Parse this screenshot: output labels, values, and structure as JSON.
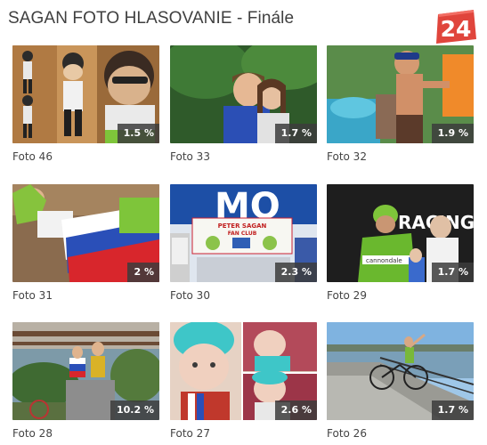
{
  "header": {
    "title": "SAGAN FOTO HLASOVANIE - Finále",
    "logo_text": "24"
  },
  "photos": [
    {
      "caption": "Foto 46",
      "percent": "1.5 %"
    },
    {
      "caption": "Foto 33",
      "percent": "1.7 %"
    },
    {
      "caption": "Foto 32",
      "percent": "1.9 %"
    },
    {
      "caption": "Foto 31",
      "percent": "2 %"
    },
    {
      "caption": "Foto 30",
      "percent": "2.3 %"
    },
    {
      "caption": "Foto 29",
      "percent": "1.7 %"
    },
    {
      "caption": "Foto 28",
      "percent": "10.2 %"
    },
    {
      "caption": "Foto 27",
      "percent": "2.6 %"
    },
    {
      "caption": "Foto 26",
      "percent": "1.7 %"
    }
  ],
  "photo_texts": {
    "banner_line1": "PETER SAGAN",
    "banner_line2": "FAN CLUB",
    "team_text": "RACING",
    "jersey_text": "cannondale"
  },
  "colors": {
    "logo_red": "#e0453c",
    "badge_bg": "#3c3c3c"
  }
}
